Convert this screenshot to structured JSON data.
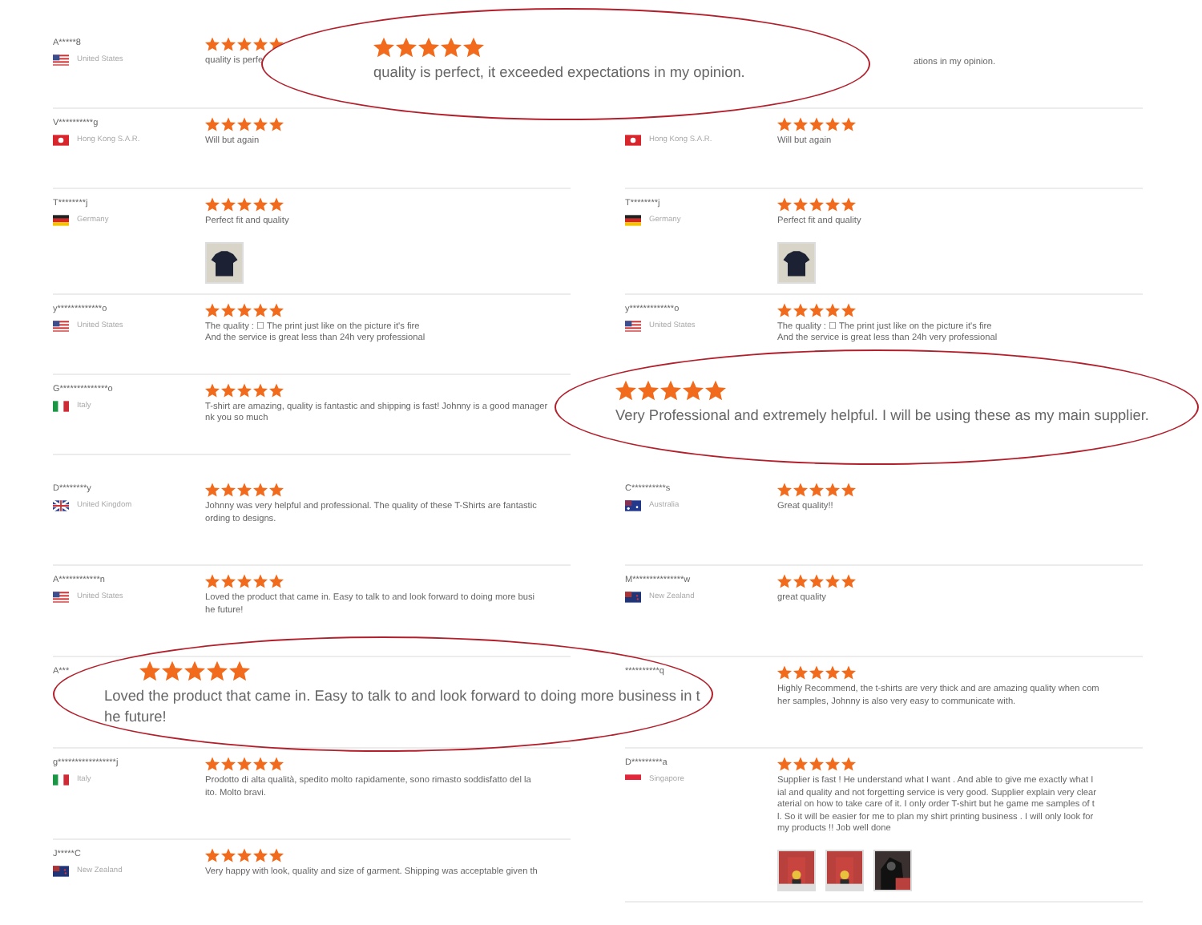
{
  "columns": [
    {
      "blocks": [
        {
          "reviews": [
            {
              "name": "A*****8",
              "flag": {
                "kind": "us"
              },
              "country": "United States",
              "stars": 5,
              "lines": [
                "quality is perfe"
              ]
            },
            {
              "name": "V**********g",
              "flag": {
                "kind": "hk"
              },
              "country": "Hong Kong S.A.R.",
              "stars": 5,
              "lines": [
                "Will but again"
              ]
            },
            {
              "name": "T********j",
              "flag": {
                "kind": "de"
              },
              "country": "Germany",
              "stars": 5,
              "lines": [
                "Perfect fit and quality"
              ],
              "photos": [
                {
                  "kind": "picture"
                }
              ]
            },
            {
              "name": "y*************o",
              "flag": {
                "kind": "us"
              },
              "country": "United States",
              "stars": 5,
              "lines": [
                "The quality : ☐ The print just like on the picture it's fire",
                "And the service is great less than 24h very professional"
              ]
            },
            {
              "name": "G**************o",
              "flag": {
                "kind": "it"
              },
              "country": "Italy",
              "stars": 5,
              "lines": [
                "T-shirt are amazing, quality is fantastic and shipping is fast! Johnny is a good manager",
                "nk you so much"
              ]
            }
          ]
        },
        {
          "reviews": [
            {
              "name": "D********y",
              "flag": {
                "kind": "gb"
              },
              "country": "United Kingdom",
              "stars": 5,
              "lines": [
                "Johnny was very helpful and professional. The quality of these T-Shirts are fantastic",
                "ording to designs."
              ]
            },
            {
              "name": "A************n",
              "flag": {
                "kind": "us"
              },
              "country": "United States",
              "stars": 5,
              "lines": [
                "Loved the product that came in. Easy to talk to and look forward to doing more busi",
                "he future!"
              ]
            },
            {
              "name": "A***"
            },
            {
              "name": "g*****************j",
              "flag": {
                "kind": "it"
              },
              "country": "Italy",
              "stars": 5,
              "lines": [
                "Prodotto di alta qualità, spedito molto rapidamente, sono rimasto soddisfatto del la",
                "ito. Molto bravi."
              ]
            },
            {
              "name": "J*****C",
              "flag": {
                "kind": "nz"
              },
              "country": "New Zealand",
              "stars": 5,
              "lines": [
                "Very happy with look, quality and size of garment. Shipping was acceptable given th"
              ]
            }
          ]
        }
      ]
    },
    {
      "blocks": [
        {
          "reviews": [
            {
              "lines": [
                "ations in my opinion."
              ]
            },
            {
              "flag": {
                "kind": "hk"
              },
              "country": "Hong Kong S.A.R.",
              "stars": 5,
              "lines": [
                "Will but again"
              ]
            },
            {
              "name": "T********j",
              "flag": {
                "kind": "de"
              },
              "country": "Germany",
              "stars": 5,
              "lines": [
                "Perfect fit and quality"
              ],
              "photos": [
                {
                  "kind": "picture"
                }
              ]
            },
            {
              "name": "y*************o",
              "flag": {
                "kind": "us"
              },
              "country": "United States",
              "stars": 5,
              "lines": [
                "The quality : ☐ The print just like on the picture it's fire",
                "And the service is great less than 24h very professional"
              ]
            }
          ]
        },
        {
          "reviews": [
            {
              "name": "C**********s",
              "flag": {
                "kind": "au"
              },
              "country": "Australia",
              "stars": 5,
              "lines": [
                "Great quality!!"
              ]
            },
            {
              "name": "M***************w",
              "flag": {
                "kind": "nz"
              },
              "country": "New Zealand",
              "stars": 5,
              "lines": [
                "great quality"
              ]
            },
            {
              "name": "**********q",
              "stars": 5,
              "lines": [
                "Highly Recommend, the t-shirts are very thick and are amazing quality when com",
                "her samples, Johnny is also very easy to communicate with."
              ]
            },
            {
              "name": "D*********a",
              "flag": {
                "kind": "sg"
              },
              "country": "Singapore",
              "stars": 5,
              "lines": [
                "Supplier is fast ! He understand what I want . And able to give me exactly what I",
                "ial and quality and not forgetting service is very good. Supplier explain very clear",
                "aterial on how to take care of it. I only order T-shirt but he game me samples of t",
                "l. So it will be easier for me to plan my shirt printing business . I will only look for",
                "my products !! Job well done"
              ],
              "photos": [
                {
                  "kind": "picture"
                },
                {
                  "kind": "picture"
                },
                {
                  "kind": "picture"
                }
              ]
            }
          ]
        }
      ]
    }
  ],
  "callouts": [
    {
      "stars": 5,
      "lines": [
        "quality is perfect, it exceeded expectations in my opinion."
      ]
    },
    {
      "stars": 5,
      "lines": [
        "Very Professional and extremely helpful. I will be using these as my main supplier."
      ]
    },
    {
      "stars": 5,
      "lines": [
        "Loved the product that came in. Easy to talk to and look forward to doing more business in t",
        "he future!"
      ]
    }
  ]
}
